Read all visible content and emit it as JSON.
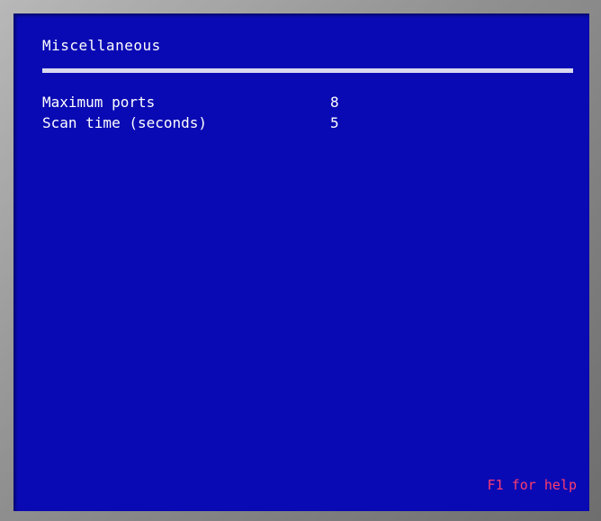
{
  "screen": {
    "title": "Miscellaneous",
    "settings": [
      {
        "label": "Maximum ports",
        "value": "8"
      },
      {
        "label": "Scan time (seconds)",
        "value": "5"
      }
    ],
    "help_hint": "F1 for help"
  },
  "colors": {
    "background": "#0a0ab4",
    "text": "#ffffff",
    "divider": "#d8d8ee",
    "help": "#ff3c6e"
  }
}
